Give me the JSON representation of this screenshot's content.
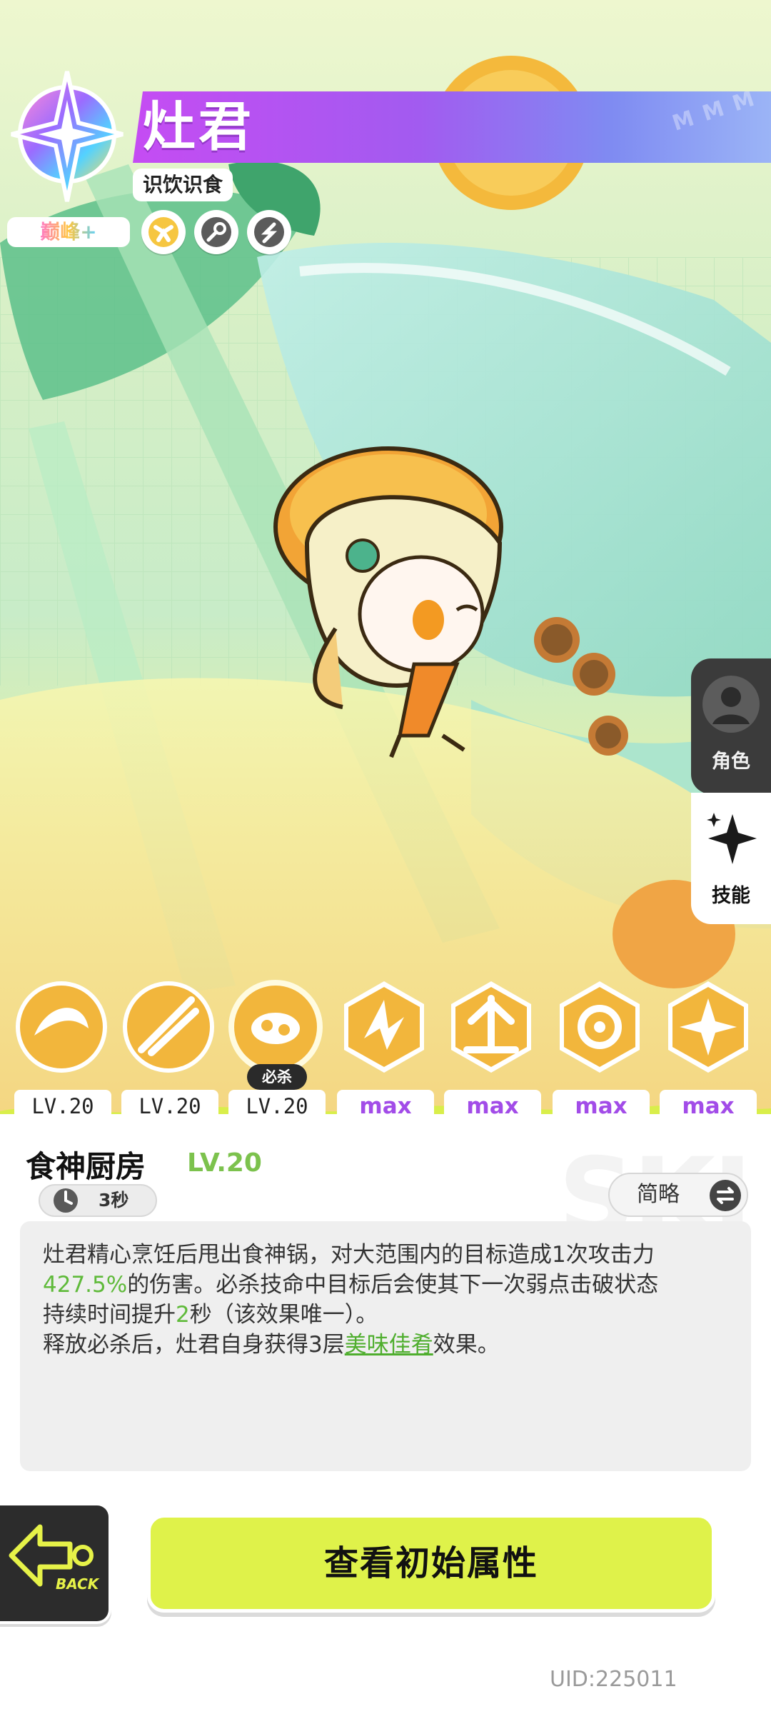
{
  "header": {
    "character_name": "灶君",
    "subtitle": "识饮识食",
    "rank": "巅峰+",
    "attribute_icons": [
      "dot-cross-icon",
      "key-icon",
      "swirl-icon"
    ],
    "banner_colors": [
      "#c54cf3",
      "#9bb4f6"
    ]
  },
  "side_tabs": {
    "role": "角色",
    "skill": "技能"
  },
  "skills": {
    "ultimate_tag": "必杀",
    "levels": [
      "LV.20",
      "LV.20",
      "LV.20",
      "max",
      "max",
      "max",
      "max"
    ]
  },
  "detail": {
    "title": "食神厨房",
    "level": "LV.20",
    "cooldown": "3秒",
    "toggle_label": "简略",
    "desc_line1_a": "灶君精心烹饪后甩出食神锅，对大范围内的目标造成1次攻击力",
    "desc_value": "427.5%",
    "desc_line2_b": "的伤害。必杀技命中目标后会使其下一次弱点击破状态",
    "desc_line3_a": "持续时间提升",
    "desc_line3_num": "2",
    "desc_line3_b": "秒（该效果唯一）。",
    "desc_line4_a": "释放必杀后，灶君自身获得3层",
    "desc_link": "美味佳肴",
    "desc_line4_b": "效果。"
  },
  "footer": {
    "back_label": "BACK",
    "cta_label": "查看初始属性",
    "uid": "UID:225011"
  },
  "colors": {
    "accent_green": "#5fba3a",
    "cta_yellow": "#dff24a",
    "max_purple": "#a24ce8"
  }
}
